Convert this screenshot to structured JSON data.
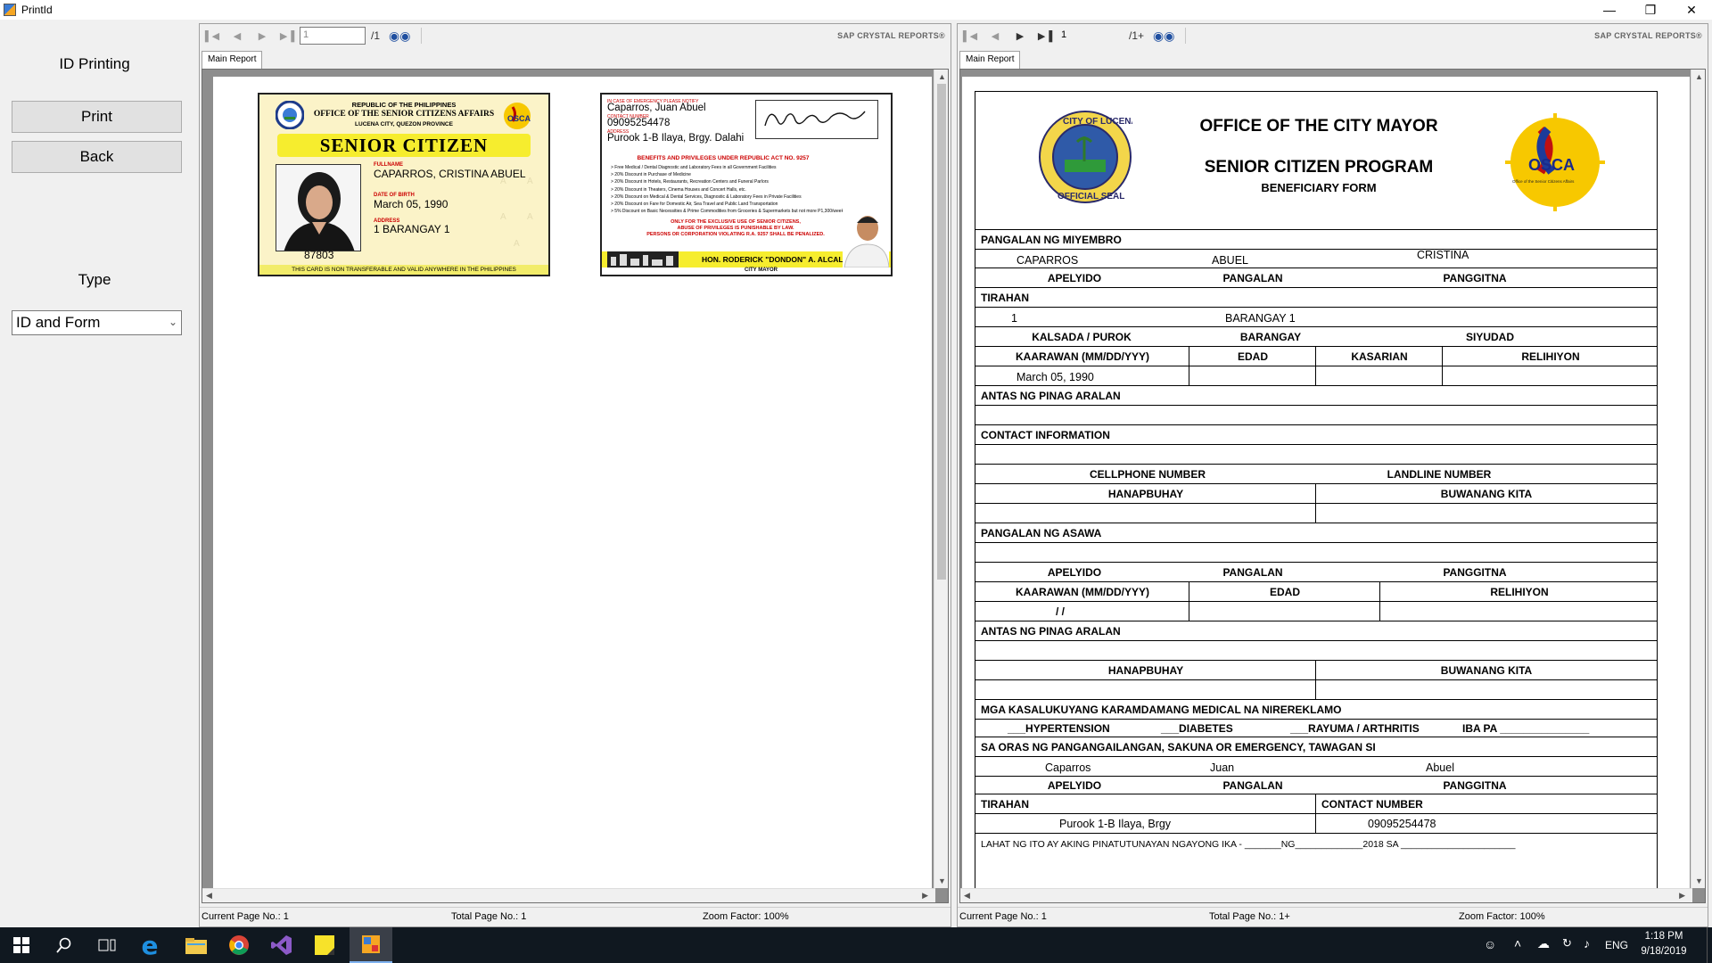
{
  "window": {
    "title": "PrintId"
  },
  "left": {
    "heading": "ID Printing",
    "print": "Print",
    "back": "Back",
    "type_label": "Type",
    "type_value": "ID and Form"
  },
  "v1": {
    "page": "1",
    "total": "/1",
    "brand": "SAP CRYSTAL REPORTS®",
    "tab": "Main Report",
    "cur": "Current Page No.: 1",
    "tot": "Total Page No.: 1",
    "zoom": "Zoom Factor: 100%"
  },
  "v2": {
    "page": "1",
    "total": "/1+",
    "brand": "SAP CRYSTAL REPORTS®",
    "tab": "Main Report",
    "cur": "Current Page No.: 1",
    "tot": "Total Page No.: 1+",
    "zoom": "Zoom Factor: 100%"
  },
  "front": {
    "l1": "REPUBLIC OF THE PHILIPPINES",
    "l2": "OFFICE OF THE SENIOR CITIZENS AFFAIRS",
    "l3": "LUCENA CITY, QUEZON PROVINCE",
    "title": "SENIOR CITIZEN",
    "name_tag": "FULLNAME",
    "name": "CAPARROS, CRISTINA ABUEL",
    "dob_tag": "DATE OF BIRTH",
    "dob": "March 05, 1990",
    "addr_tag": "ADDRESS",
    "addr": "1 BARANGAY 1",
    "idno": "87803",
    "footer": "THIS CARD IS NON TRANSFERABLE AND VALID ANYWHERE IN THE PHILIPPINES"
  },
  "back": {
    "ice_tag": "IN CASE OF EMERGENCY PLEASE NOTIFY",
    "ice_name": "Caparros, Juan Abuel",
    "contact_tag": "CONTACT NUMBER",
    "contact": "09095254478",
    "addr_tag": "ADDRESS",
    "addr": "Purook 1-B Ilaya, Brgy. Dalahi",
    "benefits_title": "BENEFITS AND PRIVILEGES UNDER REPUBLIC ACT NO. 9257",
    "benefits": [
      "> Free Medical / Dental Diagnostic and Laboratory Fees in all Government Facilities",
      "> 20% Discount in Purchase of Medicine",
      "> 20% Discount in Hotels, Restaurants, Recreation Centers and Funeral Parlors",
      "> 20% Discount in Theaters, Cinema Houses and Concert Halls, etc.",
      "> 20% Discount on Medical & Dental Services, Diagnostic & Laboratory Fees in Private Facilities",
      "> 20% Discount on Fare for Domestic Air, Sea Travel and Public Land Transportation",
      "> 5% Discount on Basic Necessities & Prime Commodities from Groceries & Supermarkets but not more P1,300/week"
    ],
    "warn1": "ONLY FOR THE EXCLUSIVE USE OF SENIOR CITIZENS,",
    "warn2": "ABUSE OF PRIVILEGES IS PUNISHABLE BY LAW.",
    "warn3": "PERSONS OR CORPORATION VIOLATING R.A. 9257 SHALL BE PENALIZED.",
    "mayor": "HON. RODERICK \"DONDON\" A. ALCALA",
    "mayor_title": "CITY MAYOR"
  },
  "form": {
    "h1": "OFFICE OF THE  CITY MAYOR",
    "h2": "SENIOR CITIZEN PROGRAM",
    "h3": "BENEFICIARY FORM",
    "seal_text": "CITY OF LUCENA",
    "seal_bottom": "OFFICIAL SEAL",
    "osca": "OSCA",
    "osca_sub": "Office of the Senior Citizens Affairs",
    "s_member": "PANGALAN NG MIYEMBRO",
    "m_last": "CAPARROS",
    "m_first": "ABUEL",
    "m_middle": "CRISTINA",
    "apelyido": "APELYIDO",
    "pangalan": "PANGALAN",
    "panggitna": "PANGGITNA",
    "s_tirahan": "TIRAHAN",
    "t_kalsada_v": "1",
    "t_brgy_v": "BARANGAY 1",
    "kalsada": "KALSADA / PUROK",
    "barangay": "BARANGAY",
    "siyudad": "SIYUDAD",
    "kaarawan": "KAARAWAN  (MM/DD/YYY)",
    "edad": "EDAD",
    "kasarian": "KASARIAN",
    "relihiyon": "RELIHIYON",
    "dob_v": "March 05, 1990",
    "antas": "ANTAS NG PINAG ARALAN",
    "contact_info": "CONTACT INFORMATION",
    "cell": "CELLPHONE NUMBER",
    "landline": "LANDLINE NUMBER",
    "hanap": "HANAPBUHAY",
    "buwan": "BUWANANG KITA",
    "asawa": "PANGALAN NG ASAWA",
    "slash": "/            /",
    "medical": "MGA KASALUKUYANG KARAMDAMANG MEDICAL NA NIREREKLAMO",
    "hyper": "___HYPERTENSION",
    "diab": "___DIABETES",
    "rayuma": "___RAYUMA / ARTHRITIS",
    "iba": "IBA PA _______________",
    "emerg": "SA ORAS NG PANGANGAILANGAN, SAKUNA OR EMERGENCY, TAWAGAN SI",
    "e_last": "Caparros",
    "e_first": "Juan",
    "e_middle": "Abuel",
    "contact_num": "CONTACT NUMBER",
    "e_addr": "Purook 1-B Ilaya, Brgy",
    "e_phone": "09095254478",
    "lahat": "LAHAT NG ITO AY AKING PINATUTUNAYAN NGAYONG IKA - _______NG_____________2018 SA ______________________"
  },
  "tray": {
    "lang": "ENG",
    "time": "1:18 PM",
    "date": "9/18/2019"
  },
  "colors": {
    "taskbar": "#101820",
    "card_bg": "#fbf3c8",
    "banner": "#f6ed2e",
    "warn_red": "#c00000"
  }
}
